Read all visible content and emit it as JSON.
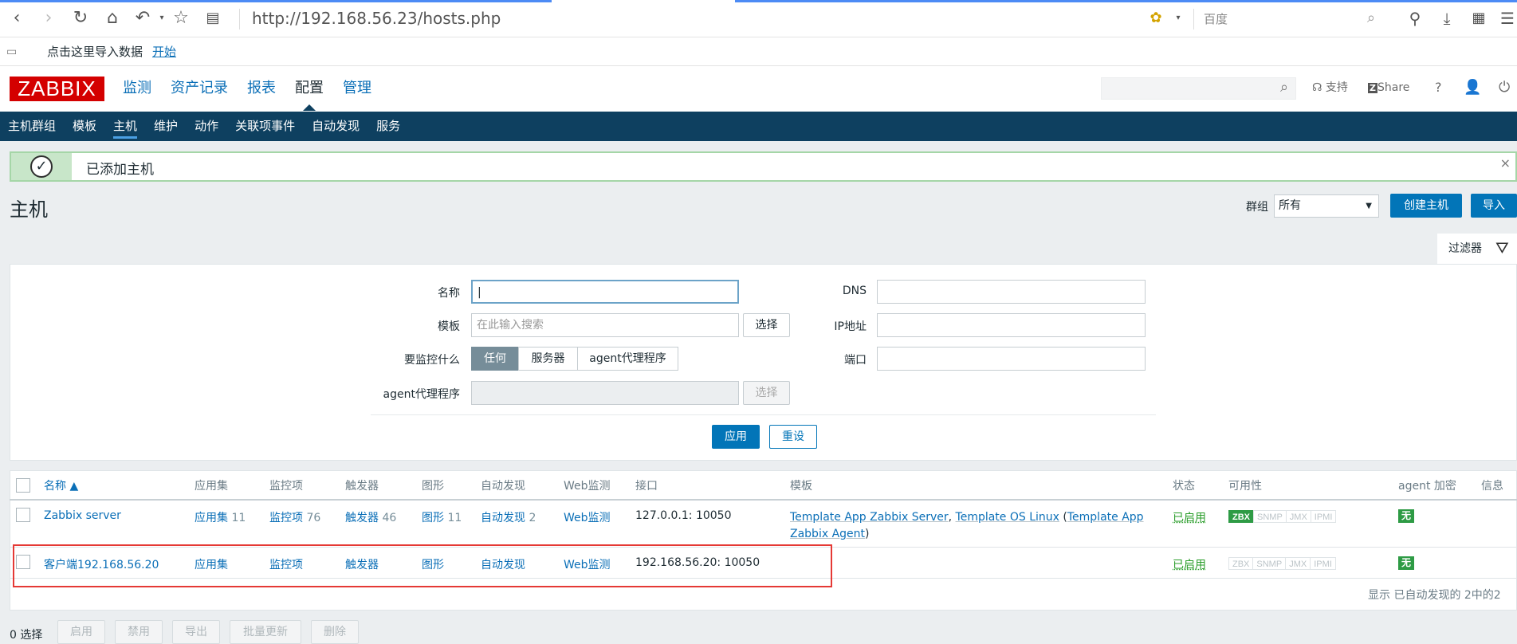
{
  "browser": {
    "url": "http://192.168.56.23/hosts.php",
    "search_placeholder": "百度",
    "bookmarks_text": "点击这里导入数据",
    "bookmarks_link": "开始"
  },
  "header": {
    "logo": "ZABBIX",
    "menu": [
      "监测",
      "资产记录",
      "报表",
      "配置",
      "管理"
    ],
    "active_menu": "配置",
    "support": "支持",
    "share": "Share",
    "help": "?"
  },
  "submenu": [
    "主机群组",
    "模板",
    "主机",
    "维护",
    "动作",
    "关联项事件",
    "自动发现",
    "服务"
  ],
  "message": {
    "text": "已添加主机",
    "status_color": "#c8e6c9"
  },
  "page": {
    "title": "主机",
    "group_label": "群组",
    "group_value": "所有",
    "create_button": "创建主机",
    "import_button": "导入",
    "filter_tab": "过滤器"
  },
  "filter": {
    "name_label": "名称",
    "name_value": "",
    "template_label": "模板",
    "template_placeholder": "在此输入搜索",
    "select_button": "选择",
    "monitor_label": "要监控什么",
    "monitor_options": [
      "任何",
      "服务器",
      "agent代理程序"
    ],
    "monitor_selected": "任何",
    "proxy_label": "agent代理程序",
    "proxy_select_button": "选择",
    "dns_label": "DNS",
    "ip_label": "IP地址",
    "port_label": "端口",
    "apply_button": "应用",
    "reset_button": "重设"
  },
  "table": {
    "headers": {
      "name": "名称 ▲",
      "applications": "应用集",
      "items": "监控项",
      "triggers": "触发器",
      "graphs": "图形",
      "discovery": "自动发现",
      "web": "Web监测",
      "interface": "接口",
      "templates": "模板",
      "status": "状态",
      "availability": "可用性",
      "encryption": "agent 加密",
      "info": "信息"
    },
    "rows": [
      {
        "name": "Zabbix server",
        "applications": "应用集",
        "applications_count": "11",
        "items": "监控项",
        "items_count": "76",
        "triggers": "触发器",
        "triggers_count": "46",
        "graphs": "图形",
        "graphs_count": "11",
        "discovery": "自动发现",
        "discovery_count": "2",
        "web": "Web监测",
        "interface": "127.0.0.1: 10050",
        "tpl1": "Template App Zabbix Server",
        "tpl2": "Template OS Linux",
        "tpl3": "Template App Zabbix Agent",
        "status": "已启用",
        "avail": [
          "ZBX",
          "SNMP",
          "JMX",
          "IPMI"
        ],
        "avail_ok": "ZBX",
        "encryption": "无"
      },
      {
        "name": "客户端192.168.56.20",
        "applications": "应用集",
        "items": "监控项",
        "triggers": "触发器",
        "graphs": "图形",
        "discovery": "自动发现",
        "web": "Web监测",
        "interface": "192.168.56.20: 10050",
        "status": "已启用",
        "avail": [
          "ZBX",
          "SNMP",
          "JMX",
          "IPMI"
        ],
        "encryption": "无"
      }
    ],
    "footer": "显示 已自动发现的 2中的2"
  },
  "bottom": {
    "selected": "0 选择",
    "buttons": [
      "启用",
      "禁用",
      "导出",
      "批量更新",
      "删除"
    ]
  }
}
